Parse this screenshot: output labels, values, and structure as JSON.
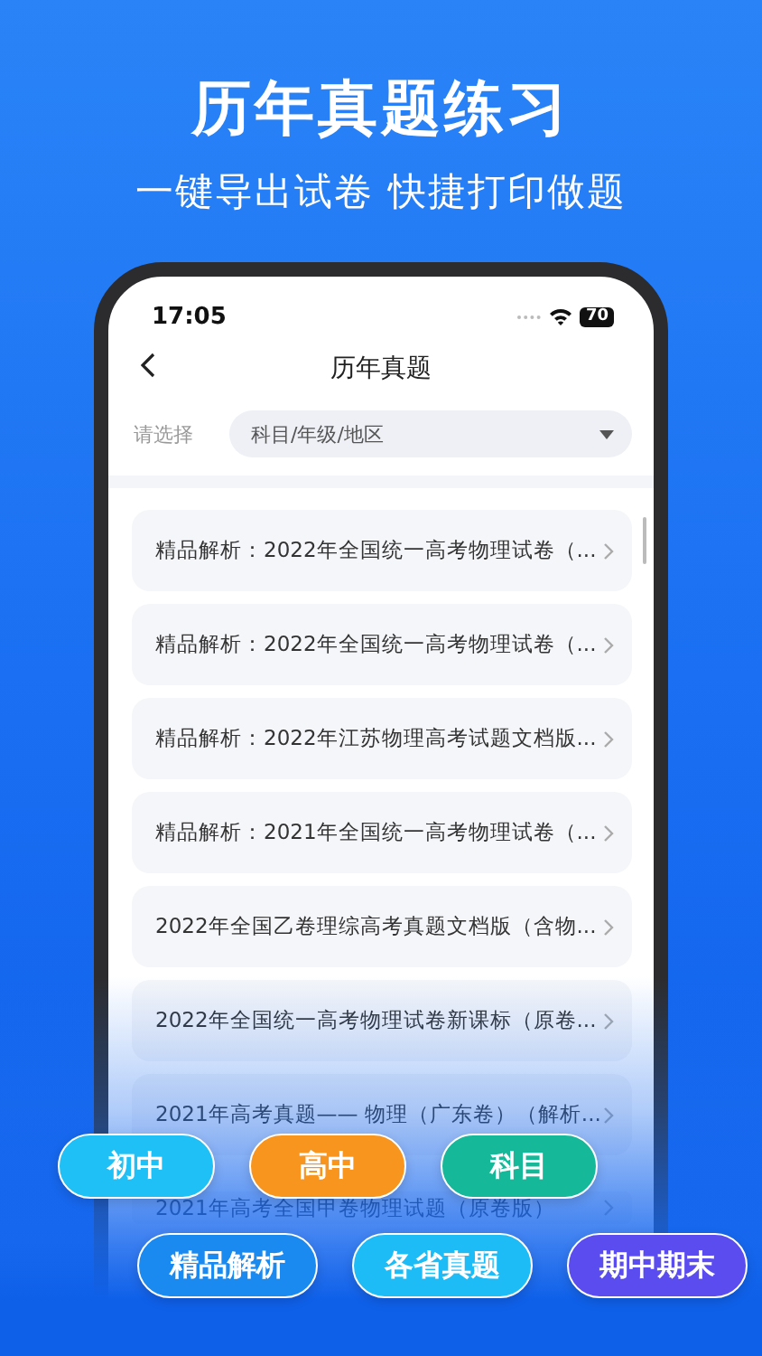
{
  "headline": "历年真题练习",
  "subtitle": "一键导出试卷 快捷打印做题",
  "status_bar": {
    "time": "17:05",
    "battery": "70"
  },
  "nav": {
    "title": "历年真题"
  },
  "filter": {
    "label": "请选择",
    "placeholder": "科目/年级/地区"
  },
  "papers": [
    {
      "title": "精品解析：2022年全国统一高考物理试卷（..."
    },
    {
      "title": "精品解析：2022年全国统一高考物理试卷（..."
    },
    {
      "title": "精品解析：2022年江苏物理高考试题文档版..."
    },
    {
      "title": "精品解析：2021年全国统一高考物理试卷（..."
    },
    {
      "title": "2022年全国乙卷理综高考真题文档版（含物..."
    },
    {
      "title": "2022年全国统一高考物理试卷新课标（原卷..."
    },
    {
      "title": "2021年高考真题—— 物理（广东卷）（解析..."
    },
    {
      "title": "2021年高考全国甲卷物理试题（原卷版）"
    }
  ],
  "tag_rows": [
    [
      {
        "label": "初中",
        "color": "#1ec0f5"
      },
      {
        "label": "高中",
        "color": "#f7951e"
      },
      {
        "label": "科目",
        "color": "#16b89a"
      }
    ],
    [
      {
        "label": "精品解析",
        "color": "#1a8af0"
      },
      {
        "label": "各省真题",
        "color": "#1dbcf6"
      },
      {
        "label": "期中期末",
        "color": "#5b4cf0"
      }
    ]
  ]
}
